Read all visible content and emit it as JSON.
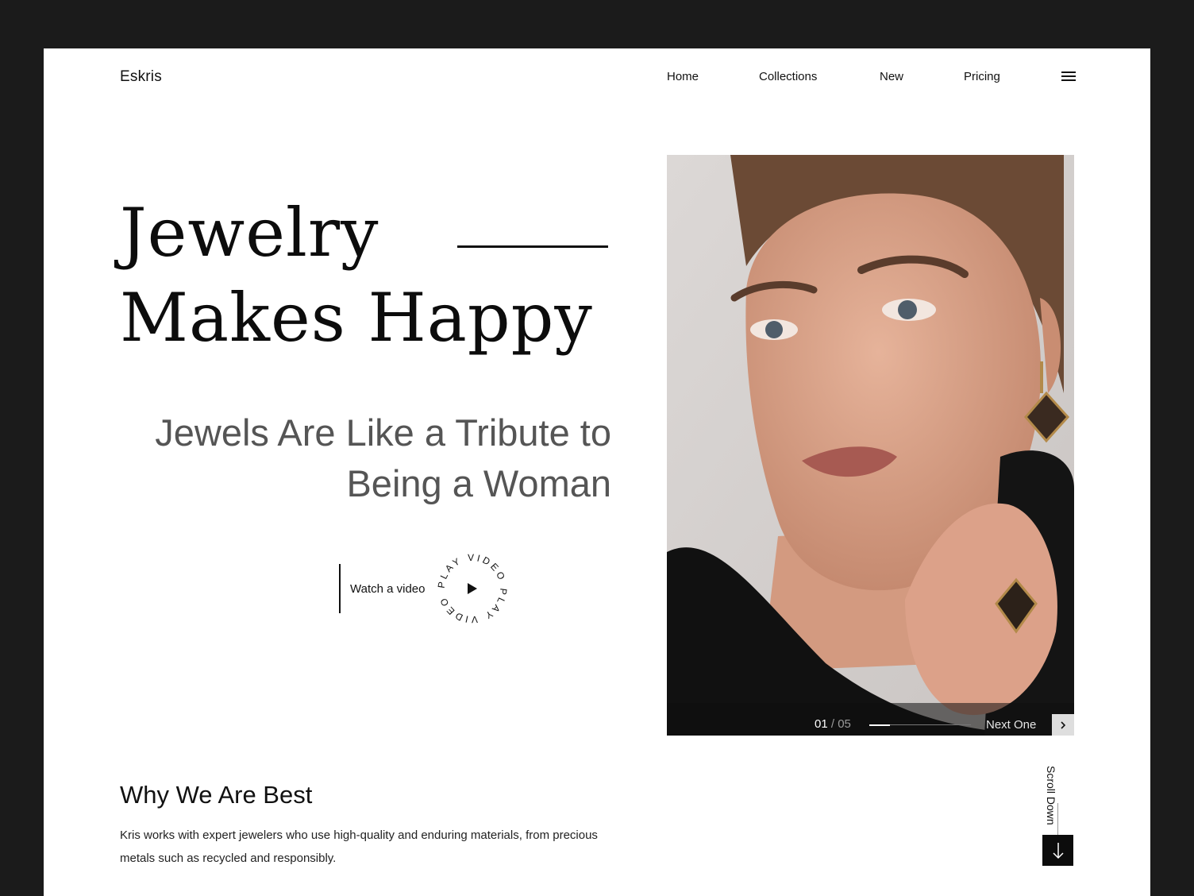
{
  "header": {
    "logo": "Eskris",
    "nav": [
      "Home",
      "Collections",
      "New",
      "Pricing"
    ],
    "menu_icon": "hamburger-menu-icon"
  },
  "hero": {
    "headline_line1": "Jewelry",
    "headline_line2": "Makes Happy",
    "subhead_line1": "Jewels Are Like a Tribute to",
    "subhead_line2": "Being a Woman",
    "watch_label": "Watch a video",
    "play_badge_text": "PLAY VIDEO PLAY VIDEO",
    "play_icon": "play-triangle-icon"
  },
  "slider": {
    "current": "01",
    "separator": "/",
    "total": "05",
    "progress_fraction": 0.2,
    "next_label": "Next One",
    "next_icon": "chevron-right-icon"
  },
  "why": {
    "title": "Why We Are Best",
    "body": "Kris works with expert jewelers who use high-quality and enduring materials, from precious metals such as recycled and responsibly."
  },
  "scroll": {
    "label": "Scroll Down",
    "icon": "arrow-down-icon"
  },
  "colors": {
    "frame": "#1b1b1b",
    "page": "#ffffff",
    "text": "#111111",
    "subhead": "#555555"
  }
}
